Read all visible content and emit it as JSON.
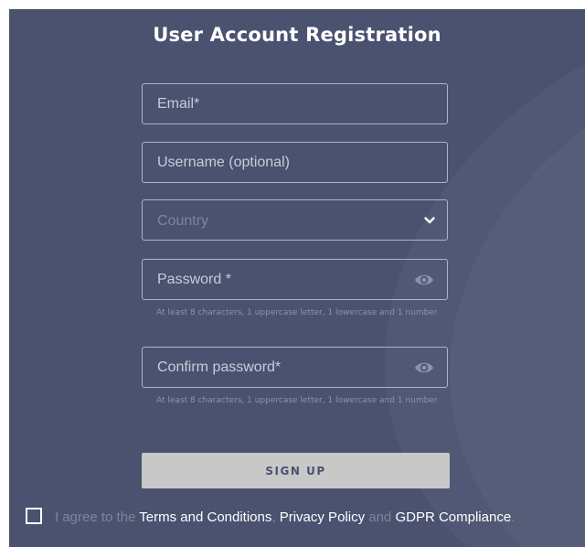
{
  "form": {
    "title": "User Account Registration",
    "email_placeholder": "Email*",
    "username_placeholder": "Username (optional)",
    "country_placeholder": "Country",
    "password_placeholder": "Password *",
    "password_hint": "At least 8 characters, 1 uppercase letter, 1 lowercase and 1 number",
    "confirm_placeholder": "Confirm password*",
    "confirm_hint": "At least 8 characters, 1 uppercase letter, 1 lowercase and 1 number",
    "signup_label": "SIGN UP"
  },
  "agreement": {
    "prefix": "I agree to the ",
    "terms": "Terms and Conditions",
    "sep": ", ",
    "privacy": "Privacy Policy",
    "and": " and ",
    "gdpr": "GDPR Compliance",
    "suffix": "."
  },
  "icons": {
    "country_dropdown": "chevron-down-icon",
    "password_toggle": "eye-icon",
    "confirm_toggle": "eye-icon"
  },
  "colors": {
    "background": "#4a5270",
    "button": "#c8c8c8",
    "text_muted": "#7e849c"
  }
}
